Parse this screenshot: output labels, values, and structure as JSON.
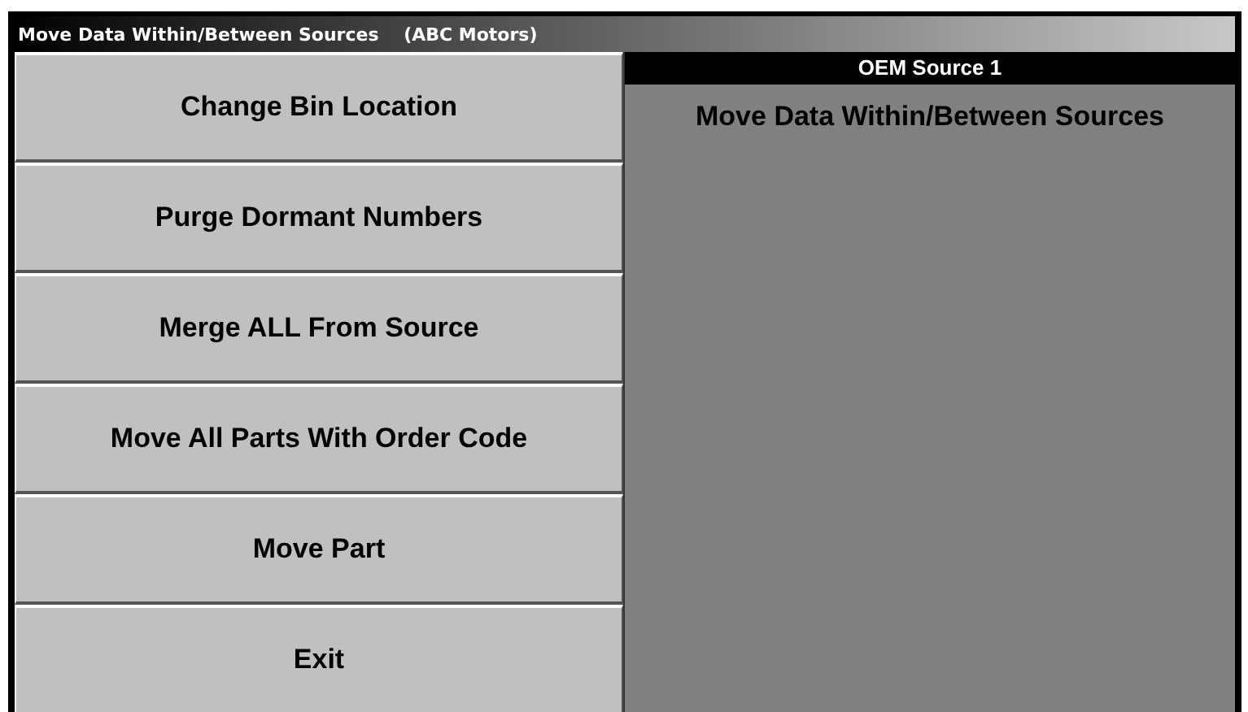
{
  "window": {
    "title": "Move Data Within/Between Sources    (ABC Motors)"
  },
  "buttons": [
    {
      "label": "Change Bin Location"
    },
    {
      "label": "Purge Dormant Numbers"
    },
    {
      "label": "Merge ALL From Source"
    },
    {
      "label": "Move All Parts With Order Code"
    },
    {
      "label": "Move Part"
    },
    {
      "label": "Exit"
    }
  ],
  "panel": {
    "header": "OEM Source 1",
    "heading": "Move Data Within/Between Sources"
  }
}
